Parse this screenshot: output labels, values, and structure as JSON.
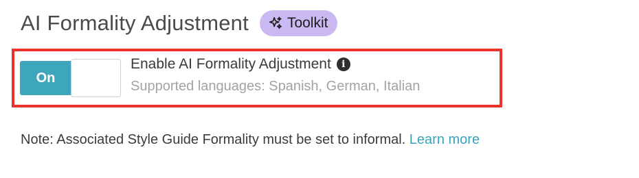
{
  "header": {
    "title": "AI Formality Adjustment",
    "badge_label": "Toolkit",
    "badge_icon": "sparkle-icon",
    "badge_color": "#cbb9f3"
  },
  "setting": {
    "toggle_state_label": "On",
    "toggle_color": "#3da6bb",
    "label": "Enable AI Formality Adjustment",
    "info_icon": "info-icon",
    "supported_languages": "Supported languages: Spanish, German, Italian"
  },
  "highlight_color": "#e8342a",
  "note": {
    "text": "Note: Associated Style Guide Formality must be set to informal.",
    "link_label": "Learn more",
    "link_color": "#3aa3b8"
  }
}
